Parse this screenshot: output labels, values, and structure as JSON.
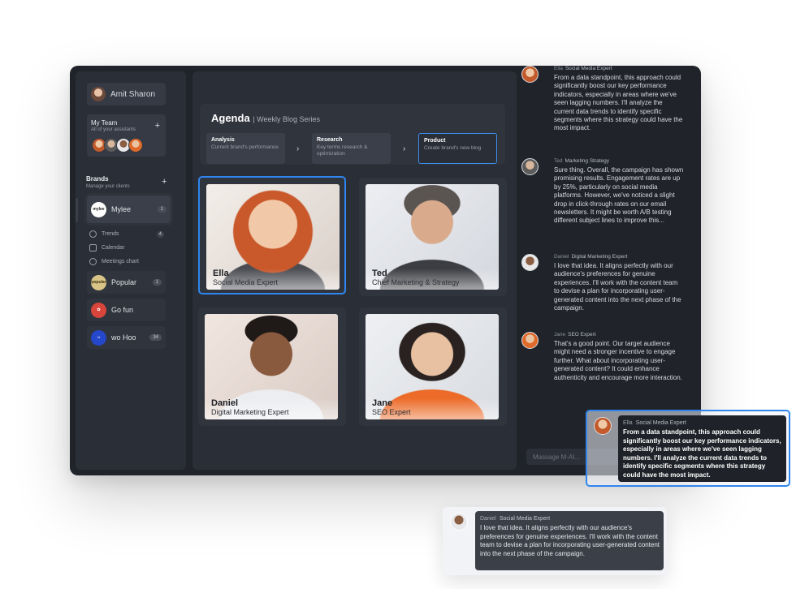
{
  "user": {
    "name": "Amit Sharon"
  },
  "team": {
    "title": "My Team",
    "subtitle": "All of your assistants"
  },
  "brands": {
    "title": "Brands",
    "subtitle": "Manage your clients",
    "items": [
      {
        "label": "Mylee",
        "count": "1",
        "logo_text": "mylee"
      },
      {
        "label": "Popular",
        "count": "1",
        "logo_text": "popular"
      },
      {
        "label": "Go fun",
        "count": "",
        "logo_text": ""
      },
      {
        "label": "wo Hoo",
        "count": "34",
        "logo_text": ""
      }
    ],
    "sub_items": [
      {
        "label": "Trends",
        "count": "4"
      },
      {
        "label": "Calendar",
        "count": ""
      },
      {
        "label": "Meetings chart",
        "count": ""
      }
    ]
  },
  "agenda": {
    "title": "Agenda",
    "series": "| Weekly Blog Series",
    "steps": [
      {
        "title": "Analysis",
        "desc": "Current brand's performance"
      },
      {
        "title": "Research",
        "desc": "Key terms research & optimization"
      },
      {
        "title": "Product",
        "desc": "Create brand's new blog"
      }
    ]
  },
  "assistants": [
    {
      "name": "Ella",
      "role": "Social Media Expert"
    },
    {
      "name": "Ted",
      "role": "Chief Marketing & Strategy"
    },
    {
      "name": "Daniel",
      "role": "Digital Marketing Expert"
    },
    {
      "name": "Jane",
      "role": "SEO Expert"
    }
  ],
  "chat": {
    "messages": [
      {
        "name": "Ella",
        "role": "Social Media Expert",
        "text": "From a data standpoint, this approach could significantly boost our key performance indicators, especially in areas where we've seen lagging numbers. I'll analyze the current data trends to identify specific segments where this strategy could have the most impact."
      },
      {
        "name": "Ted",
        "role": "Marketing Strategy",
        "text": "Sure thing. Overall, the campaign has shown promising results. Engagement rates are up by 25%, particularly on social media platforms. However, we've noticed a slight drop in click-through rates on our email newsletters. It might be worth A/B testing different subject lines to improve this..."
      },
      {
        "name": "Daniel",
        "role": "Digital Marketing Expert",
        "text": "I love that idea. It aligns perfectly with our audience's preferences for genuine experiences. I'll work with the content team to devise a plan for incorporating user-generated content into the next phase of the campaign."
      },
      {
        "name": "Jane",
        "role": "SEO Expert",
        "text": "That's a good point. Our target audience might need a stronger incentive to engage further. What about incorporating user-generated content? It could enhance authenticity and encourage more interaction."
      }
    ],
    "input_placeholder": "Massage M-AI..."
  },
  "popups": [
    {
      "name": "Ella",
      "role": "Social Media Expert",
      "text": "From a data standpoint, this approach could significantly boost our key performance indicators, especially in areas where we've seen lagging numbers. I'll analyze the current data trends to identify specific segments where this strategy could have the most impact."
    },
    {
      "name": "Daniel",
      "role": "Social Media Expert",
      "text": "I love that idea. It aligns perfectly with our audience's preferences for genuine experiences. I'll work with the content team to devise a plan for incorporating user-generated content into the next phase of the campaign."
    }
  ],
  "colors": {
    "accent": "#2f86f0",
    "window_bg": "#202329",
    "panel_bg": "#2a2e36"
  }
}
